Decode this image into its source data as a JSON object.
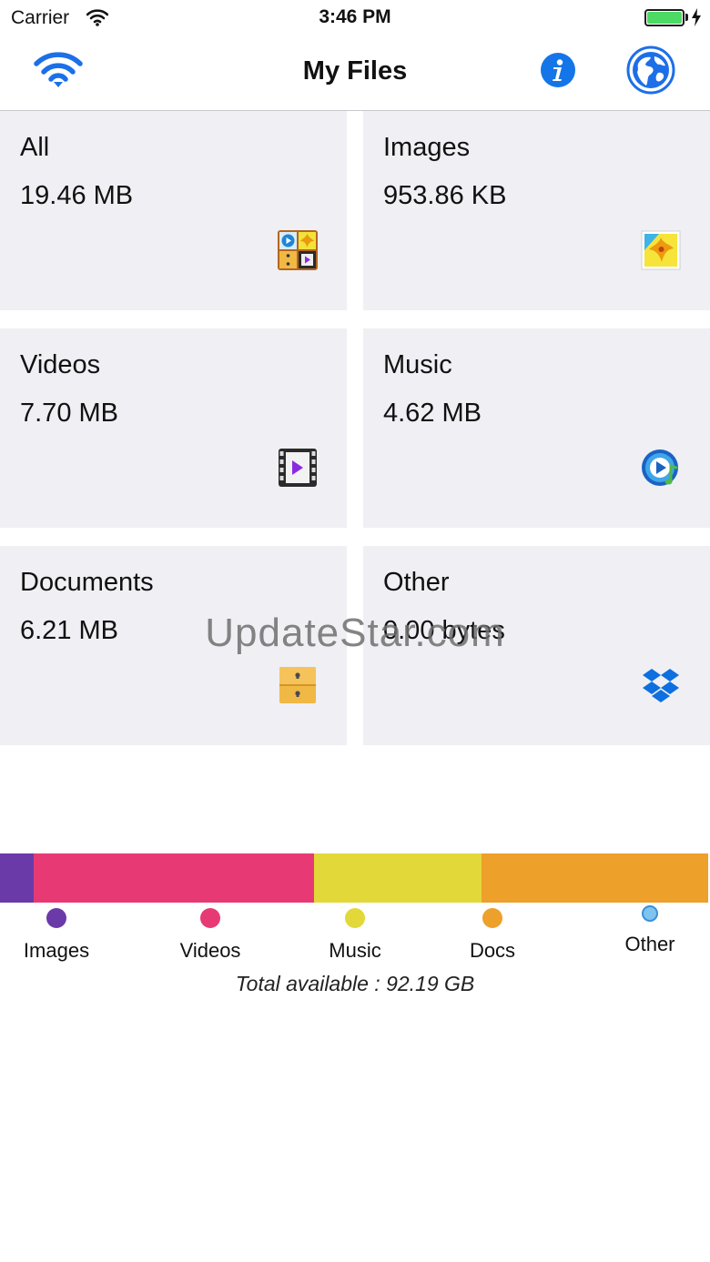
{
  "status_bar": {
    "carrier": "Carrier",
    "time": "3:46 PM",
    "battery_level": 1.0
  },
  "nav": {
    "title": "My Files",
    "left_icon": "wifi-icon",
    "right_icons": [
      "info-icon",
      "globe-icon"
    ]
  },
  "tiles": [
    {
      "label": "All",
      "size": "19.46 MB",
      "icon": "all-files-icon"
    },
    {
      "label": "Images",
      "size": "953.86 KB",
      "icon": "image-icon"
    },
    {
      "label": "Videos",
      "size": "7.70 MB",
      "icon": "film-icon"
    },
    {
      "label": "Music",
      "size": "4.62 MB",
      "icon": "music-icon"
    },
    {
      "label": "Documents",
      "size": "6.21 MB",
      "icon": "cabinet-icon"
    },
    {
      "label": "Other",
      "size": "0.00 bytes",
      "icon": "dropbox-icon"
    }
  ],
  "watermark": "UpdateStar.com",
  "storage": {
    "segments": [
      {
        "category": "Images",
        "fraction": 0.047,
        "color": "#6a3aa8"
      },
      {
        "category": "Videos",
        "fraction": 0.396,
        "color": "#e73a75"
      },
      {
        "category": "Music",
        "fraction": 0.237,
        "color": "#e2d83a"
      },
      {
        "category": "Docs",
        "fraction": 0.32,
        "color": "#eda02a"
      },
      {
        "category": "Other",
        "fraction": 0.0,
        "color": "#7dc4ef"
      }
    ],
    "legend": [
      {
        "label": "Images",
        "color": "#6a3aa8"
      },
      {
        "label": "Videos",
        "color": "#e73a75"
      },
      {
        "label": "Music",
        "color": "#e2d83a"
      },
      {
        "label": "Docs",
        "color": "#eda02a"
      },
      {
        "label": "Other",
        "color": "#7dc4ef"
      }
    ],
    "total": "Total available : 92.19 GB"
  }
}
